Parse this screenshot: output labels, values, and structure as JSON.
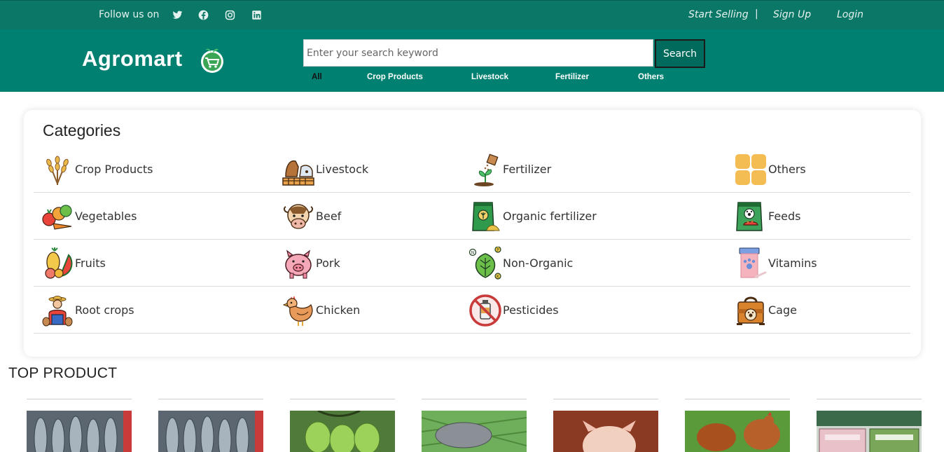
{
  "topbar": {
    "follow_label": "Follow us on",
    "social_icons": [
      "twitter-icon",
      "facebook-icon",
      "instagram-icon",
      "linkedin-icon"
    ],
    "start_selling": "Start Selling",
    "separator": "|",
    "sign_up": "Sign Up",
    "login": "Login"
  },
  "header": {
    "brand": "Agromart",
    "search_placeholder": "Enter your search keyword",
    "search_button": "Search",
    "filters": [
      "All",
      "Crop Products",
      "Livestock",
      "Fertilizer",
      "Others"
    ],
    "active_filter": "All"
  },
  "categories": {
    "title": "Categories",
    "rows": [
      [
        "Crop Products",
        "Livestock",
        "Fertilizer",
        "Others"
      ],
      [
        "Vegetables",
        "Beef",
        "Organic fertilizer",
        "Feeds"
      ],
      [
        "Fruits",
        "Pork",
        "Non-Organic",
        "Vitamins"
      ],
      [
        "Root crops",
        "Chicken",
        "Pesticides",
        "Cage"
      ]
    ]
  },
  "top_product": {
    "title": "TOP PRODUCT"
  },
  "colors": {
    "topbar": "#0a7767",
    "header": "#008070",
    "search_button": "#006b5d"
  }
}
